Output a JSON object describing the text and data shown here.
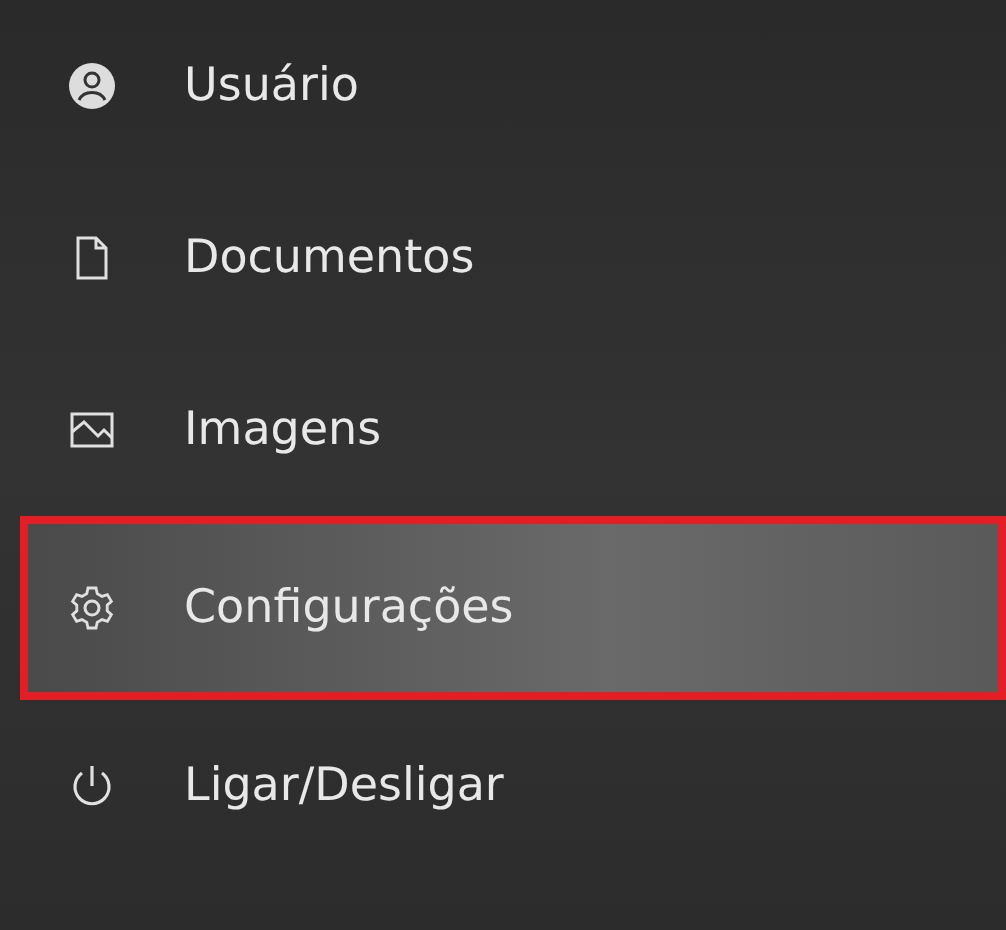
{
  "menu": {
    "items": [
      {
        "kind": "user",
        "label": "Usuário",
        "selected": false,
        "outlined": false
      },
      {
        "kind": "document",
        "label": "Documentos",
        "selected": false,
        "outlined": false
      },
      {
        "kind": "image",
        "label": "Imagens",
        "selected": false,
        "outlined": false
      },
      {
        "kind": "settings",
        "label": "Configurações",
        "selected": true,
        "outlined": true
      },
      {
        "kind": "power",
        "label": "Ligar/Desligar",
        "selected": false,
        "outlined": false
      }
    ]
  }
}
